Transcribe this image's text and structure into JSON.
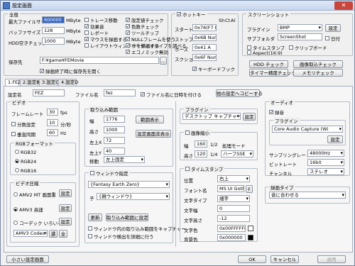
{
  "window": {
    "title": "設定画面"
  },
  "general": {
    "caption": "全般",
    "max_file_label": "最大ファイルサイズ",
    "max_file_value": "600000",
    "max_file_unit": "MByte",
    "buffer_label": "バッファサイズ",
    "buffer_value": "128",
    "buffer_unit": "MByte",
    "hdd_label": "HDD空きチェック",
    "hdd_value": "1000",
    "hdd_unit": "MByte",
    "save_label": "保存先",
    "save_value": "F:¥game¥FEMovie",
    "browse": "...",
    "open_after": "録画終了時に保存先を開く"
  },
  "checks_col1": [
    "トレース移動",
    "効果音",
    "レポート",
    "マウスを録画する",
    "レイアウトウィンドウを録画する"
  ],
  "checks_col2": [
    "設定値チェック",
    "色数チェック",
    "ツールチップ",
    "NULLフレームを使う",
    "オーディオタイプを調べる",
    "エコノミック無効"
  ],
  "hotkey": {
    "caption": "ホットキー",
    "cols": [
      "Sh",
      "Ct",
      "Al"
    ],
    "rows": [
      {
        "label": "スタート",
        "value": "0x76(F7 Num"
      },
      {
        "label": "ストップ",
        "value": "0x6B Num"
      },
      {
        "label": "ポーズ",
        "value": "0x41 A"
      },
      {
        "label": "スクショ",
        "value": "0x6F Num"
      }
    ],
    "keyhook": "キーボードフック"
  },
  "screenshot": {
    "caption": "スクリーンショット",
    "plugin_label": "プラグイン",
    "plugin_value": "BMP",
    "settings": "設定",
    "subfolder_label": "サブフォルダ",
    "subfolder_value": "ScreenShot",
    "date": "日付",
    "timestamp": "タイムスタンプ",
    "clipboard": "クリップボード",
    "aspect": "Aspect(16:9)"
  },
  "buttons_right": [
    "HDD チェック",
    "画像取込チェック",
    "タイマー精度チェック",
    "メモリチェック"
  ],
  "tabs": [
    "1.FEZ",
    "2.設定B",
    "3.設定C",
    "4.設定D"
  ],
  "profile": {
    "name_label": "設定名",
    "name_value": "FEZ",
    "file_label": "ファイル名",
    "file_value": "fez",
    "date_in_name": "ファイル名に日時を付ける",
    "copy_btn": "他の設定へコピーする"
  },
  "video": {
    "caption": "ビデオ",
    "fps_label": "フレームレート",
    "fps_value": "30",
    "fps_unit": "fps",
    "frac_label": "分数設定",
    "frac_value": "10",
    "frac_unit": "分/秒",
    "vsync_label": "垂直同期",
    "vsync_value": "60",
    "vsync_unit": "Hz",
    "rgb_caption": "RGBフォーマット",
    "rgb": [
      "RGB32",
      "RGB24",
      "RGB16"
    ],
    "rgb_selected": 1,
    "comp_caption": "ビデオ圧縮",
    "comp": [
      {
        "label": "AMV2 MT 画面重",
        "btn": "設定"
      },
      {
        "label": "AMV3 高速",
        "btn": "設定"
      },
      {
        "label": "コーデック いろいろ",
        "btn": "設定"
      }
    ],
    "comp_selected": 1,
    "codec_value": "AMV3 Codec (VV",
    "codec_sel": "選",
    "codec_all": "全"
  },
  "capture": {
    "caption": "取り込み範囲",
    "rows": [
      {
        "label": "幅",
        "value": "1776"
      },
      {
        "label": "高さ",
        "value": "1000"
      },
      {
        "label": "左上X",
        "value": "72"
      },
      {
        "label": "左上Y",
        "value": "40"
      }
    ],
    "btn_show": "範囲表示",
    "btn_hide": "設定画面非表示",
    "move_label": "移動",
    "move_value": "左上固定"
  },
  "window_spec": {
    "caption": "ウィンドウ指定",
    "title_value": "{Fantasy Earth Zero}",
    "child_label": "子",
    "child_value": "{親ウィンドウ}",
    "update": "更新",
    "set_range": "取り込み範囲に設定",
    "opt1": "ウィンドウ内の取り込み範囲をキャプチャー",
    "opt2": "ウィンドウ検出を詳細に行う"
  },
  "plugin": {
    "caption": "プラグイン",
    "value": "デスクトップ キャプチャー",
    "btn": "設定"
  },
  "shrink": {
    "caption": "画像縮小",
    "w_label": "幅",
    "w_value": "160",
    "ratio1": "1/2",
    "h_label": "高さ",
    "h_value": "120",
    "ratio2": "1/4",
    "mode_label": "処理モード",
    "mode_value": "ハーフSSE"
  },
  "timestamp": {
    "caption": "タイムスタンプ",
    "rows": [
      {
        "label": "位置",
        "value": "右上"
      },
      {
        "label": "フォント名",
        "value": "MS UI Gothic",
        "btn": "F"
      },
      {
        "label": "文字タイプ",
        "value": "細字"
      },
      {
        "label": "文字幅",
        "value": "0"
      },
      {
        "label": "文字高さ",
        "value": "-12"
      },
      {
        "label": "文字色",
        "value": "0x00FFFFFF",
        "swatch": "#ffffff"
      },
      {
        "label": "背景色",
        "value": "0x000000",
        "swatch": "#000000"
      }
    ]
  },
  "audio": {
    "caption": "オーディオ",
    "record": "録音",
    "plugin_caption": "プラグイン",
    "plugin_value": "Core Audio Capture (Wi",
    "btn": "設定",
    "rate_label": "サンプリングレート",
    "rate_value": "48000Hz",
    "bits_label": "ビットレート",
    "bits_value": "16bit",
    "ch_label": "チャンネル",
    "ch_value": "ステレオ",
    "type_caption": "録画タイプ",
    "type_value": "音に合わせる"
  },
  "footer": {
    "small": "小さい設定画面",
    "ok": "OK",
    "cancel": "キャンセル",
    "apply": "適用"
  }
}
